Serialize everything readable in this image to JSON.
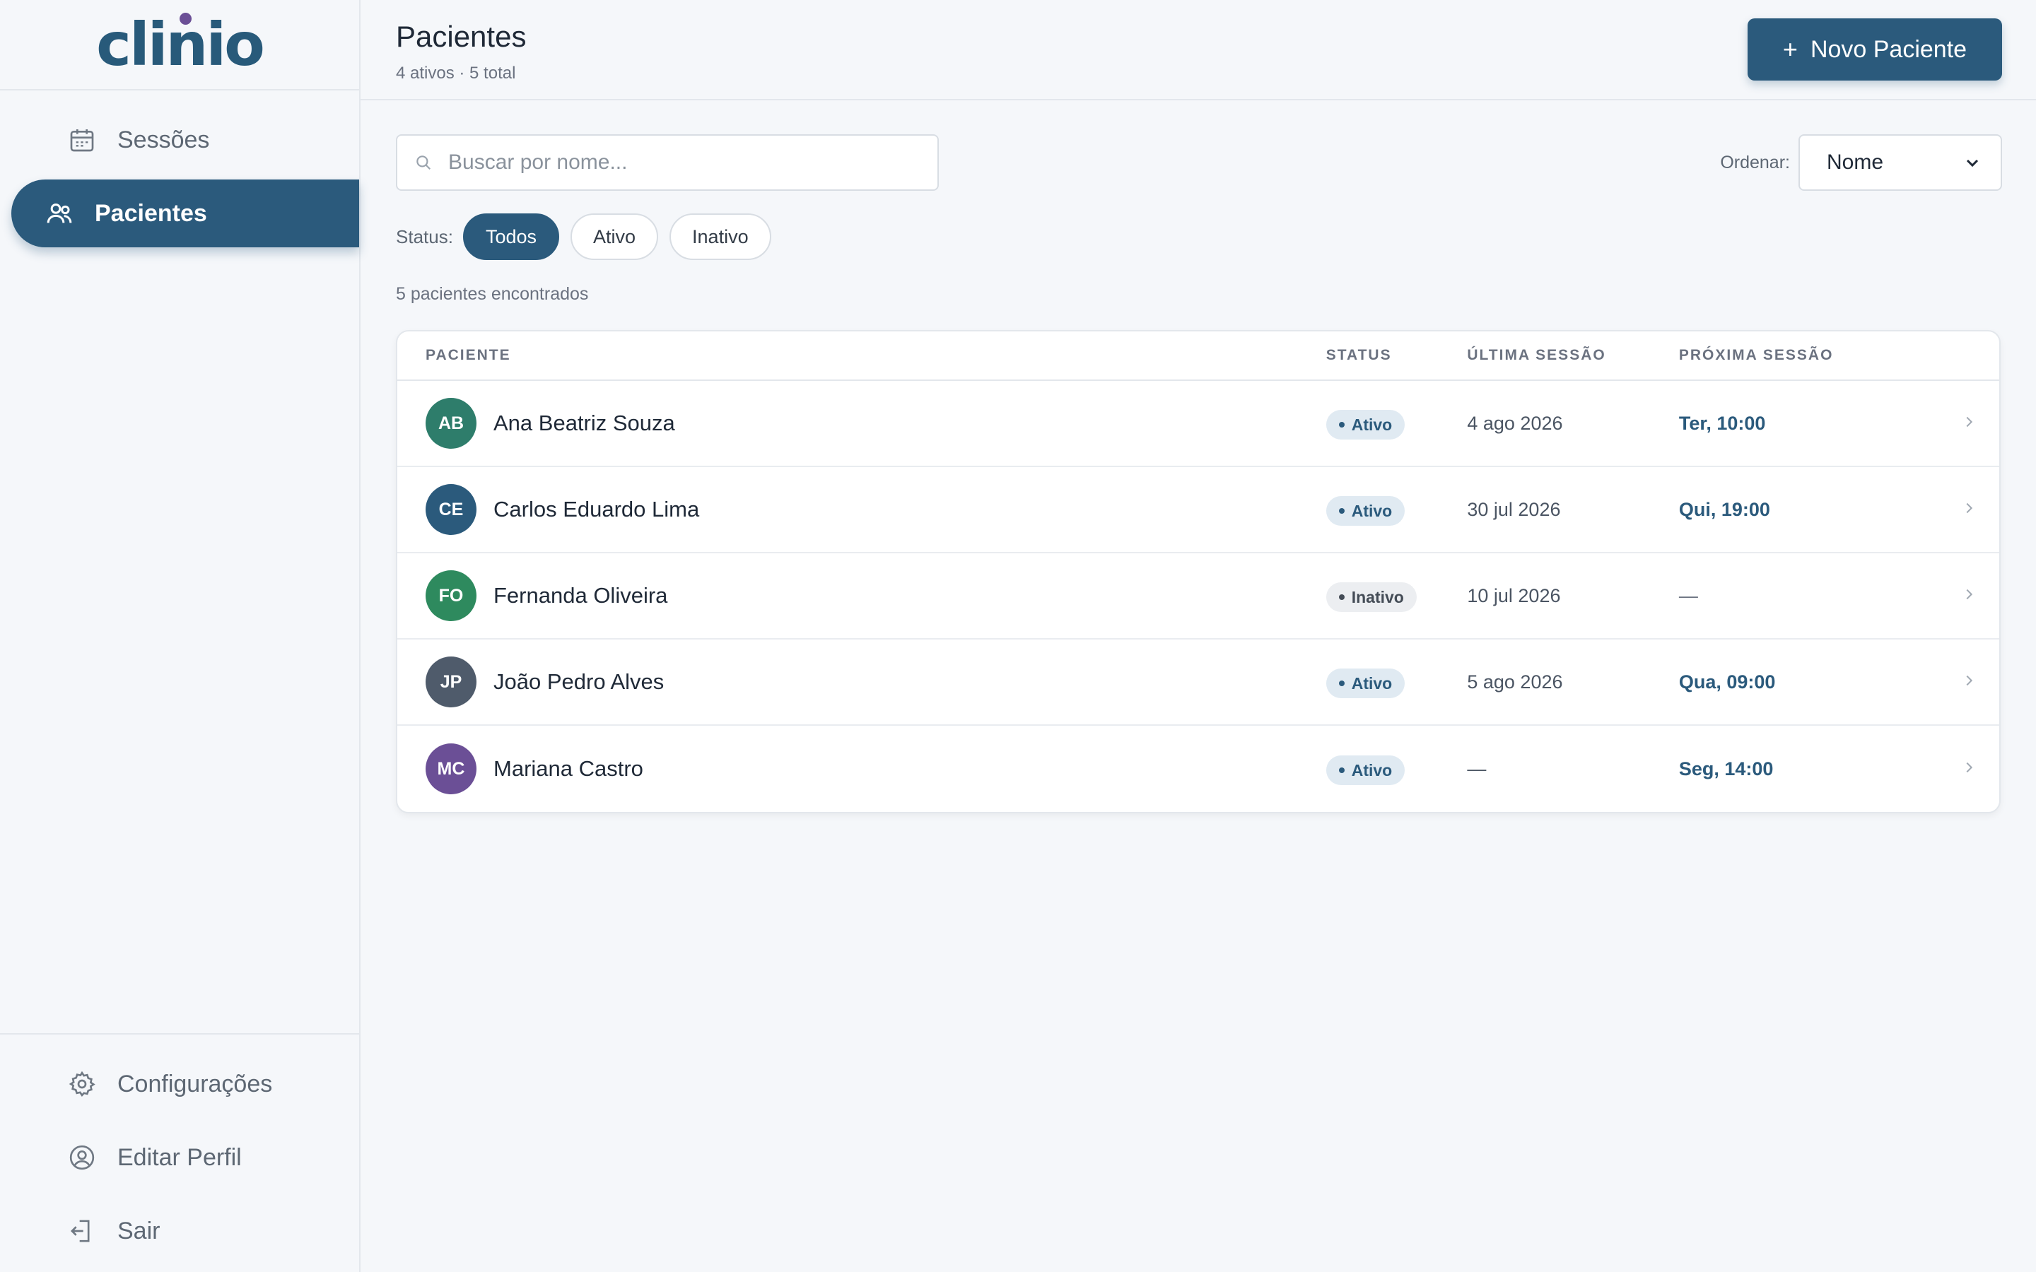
{
  "app": {
    "logo_text": "clinio"
  },
  "sidebar": {
    "items": [
      {
        "label": "Sessões",
        "icon": "calendar-icon",
        "active": false
      },
      {
        "label": "Pacientes",
        "icon": "users-icon",
        "active": true
      }
    ],
    "bottom_items": [
      {
        "label": "Configurações",
        "icon": "gear-icon"
      },
      {
        "label": "Editar Perfil",
        "icon": "user-circle-icon"
      },
      {
        "label": "Sair",
        "icon": "logout-icon"
      }
    ]
  },
  "header": {
    "title": "Pacientes",
    "subtitle": "4 ativos · 5 total",
    "new_button_plus": "+",
    "new_button_label": "Novo Paciente"
  },
  "search": {
    "placeholder": "Buscar por nome...",
    "value": ""
  },
  "sort": {
    "label": "Ordenar:",
    "selected": "Nome"
  },
  "filter": {
    "label": "Status:",
    "options": [
      "Todos",
      "Ativo",
      "Inativo"
    ],
    "selected": "Todos"
  },
  "results": {
    "count_text": "5 pacientes encontrados"
  },
  "table": {
    "columns": [
      "PACIENTE",
      "STATUS",
      "ÚLTIMA SESSÃO",
      "PRÓXIMA SESSÃO"
    ],
    "rows": [
      {
        "initials": "AB",
        "name": "Ana Beatriz Souza",
        "status": "Ativo",
        "last": "4 ago 2026",
        "next": "Ter, 10:00",
        "avatar_color": "#2e7d6b"
      },
      {
        "initials": "CE",
        "name": "Carlos Eduardo Lima",
        "status": "Ativo",
        "last": "30 jul 2026",
        "next": "Qui, 19:00",
        "avatar_color": "#2b5a7c"
      },
      {
        "initials": "FO",
        "name": "Fernanda Oliveira",
        "status": "Inativo",
        "last": "10 jul 2026",
        "next": "—",
        "avatar_color": "#2e8a5e"
      },
      {
        "initials": "JP",
        "name": "João Pedro Alves",
        "status": "Ativo",
        "last": "5 ago 2026",
        "next": "Qua, 09:00",
        "avatar_color": "#4f5b6b"
      },
      {
        "initials": "MC",
        "name": "Mariana Castro",
        "status": "Ativo",
        "last": "—",
        "next": "Seg, 14:00",
        "avatar_color": "#6b4f96"
      }
    ]
  },
  "colors": {
    "accent": "#2b5a7c",
    "logo_dot": "#6b4f96",
    "badge_ativo_bg": "#e0eaf2",
    "badge_inativo_bg": "#eceef1"
  }
}
